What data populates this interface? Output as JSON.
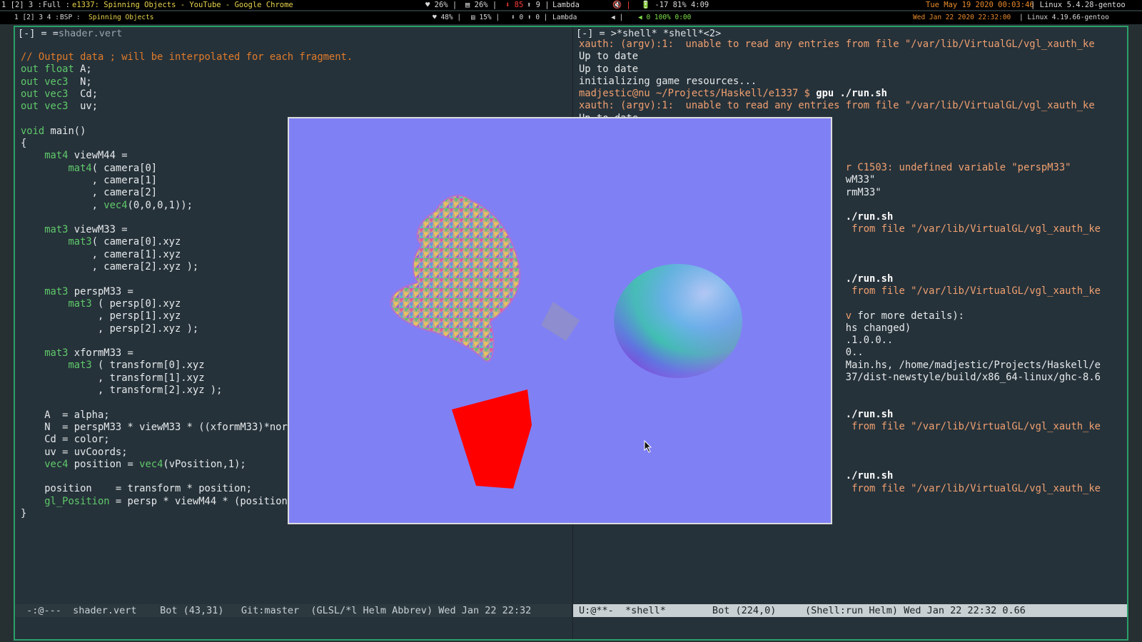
{
  "bar1": {
    "workspaces": "1 [2] 3 :",
    "layout": "Full :",
    "title": "e1337: Spinning Objects - YouTube - Google Chrome",
    "cpu": "♥ 26% |",
    "mem": "▤ 26% |",
    "net_down": "⬇ 85",
    "net_up": "⬆ 9 |",
    "wm": "Lambda",
    "vol": "🔇 |",
    "battery": "🔋 -17 81% 4:09",
    "date": "Tue May 19 2020 00:03:46",
    "kernel": "| Linux 5.4.28-gentoo"
  },
  "bar2": {
    "workspaces": "1 [2] 3 4 :",
    "layout": "BSP :",
    "title": "Spinning Objects",
    "cpu": "♥ 48% |",
    "mem": "▤ 15% |",
    "net": "⬇ 0 ⬆ 0 |",
    "wm": "Lambda",
    "vol": "◀ |",
    "battery": "◀ 0 100% 0:00",
    "date": "Wed Jan 22 2020 22:32:00",
    "kernel": "| Linux 4.19.66-gentoo"
  },
  "left": {
    "header_prefix": "[-] = =",
    "file": "shader.vert",
    "modeline": " -:@---  shader.vert    Bot (43,31)   Git:master  (GLSL/*l Helm Abbrev) Wed Jan 22 22:32"
  },
  "right": {
    "header": "[-] = >*shell* *shell*<2>",
    "modeline": "U:@**-  *shell*        Bot (224,0)     (Shell:run Helm) Wed Jan 22 22:32 0.66"
  }
}
